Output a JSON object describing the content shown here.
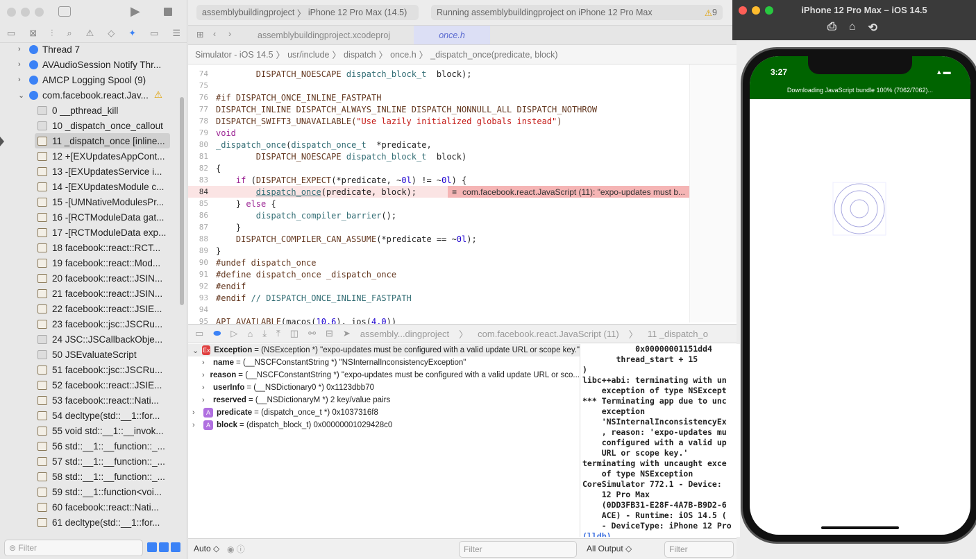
{
  "toolbar": {
    "scheme": "assemblybuildingproject",
    "device": "iPhone 12 Pro Max (14.5)",
    "status": "Running assemblybuildingproject on iPhone 12 Pro Max",
    "warnings": "9"
  },
  "tabs": [
    {
      "label": "assemblybuildingproject.xcodeproj"
    },
    {
      "label": "once.h"
    }
  ],
  "breadcrumb": [
    "Simulator - iOS 14.5",
    "usr/include",
    "dispatch",
    "once.h",
    "_dispatch_once(predicate, block)"
  ],
  "sidebar": {
    "threads": [
      {
        "label": "Thread 7"
      },
      {
        "label": "AVAudioSession Notify Thr..."
      },
      {
        "label": "AMCP Logging Spool (9)"
      },
      {
        "label": "com.facebook.react.Jav..."
      }
    ],
    "frames": [
      {
        "label": "0 __pthread_kill",
        "sys": true
      },
      {
        "label": "10 _dispatch_once_callout",
        "sys": true
      },
      {
        "label": "11 _dispatch_once [inline...",
        "selected": true
      },
      {
        "label": "12 +[EXUpdatesAppCont..."
      },
      {
        "label": "13 -[EXUpdatesService i..."
      },
      {
        "label": "14 -[EXUpdatesModule c..."
      },
      {
        "label": "15 -[UMNativeModulesPr..."
      },
      {
        "label": "16 -[RCTModuleData gat..."
      },
      {
        "label": "17 -[RCTModuleData exp..."
      },
      {
        "label": "18 facebook::react::RCT..."
      },
      {
        "label": "19 facebook::react::Mod..."
      },
      {
        "label": "20 facebook::react::JSIN..."
      },
      {
        "label": "21 facebook::react::JSIN..."
      },
      {
        "label": "22 facebook::react::JSIE..."
      },
      {
        "label": "23 facebook::jsc::JSCRu..."
      },
      {
        "label": "24 JSC::JSCallbackObje...",
        "sys": true
      },
      {
        "label": "50 JSEvaluateScript",
        "sys": true
      },
      {
        "label": "51 facebook::jsc::JSCRu..."
      },
      {
        "label": "52 facebook::react::JSIE..."
      },
      {
        "label": "53 facebook::react::Nati..."
      },
      {
        "label": "54 decltype(std::__1::for..."
      },
      {
        "label": "55 void std::__1::__invok..."
      },
      {
        "label": "56 std::__1::__function::_..."
      },
      {
        "label": "57 std::__1::__function::_..."
      },
      {
        "label": "58 std::__1::__function::_..."
      },
      {
        "label": "59 std::__1::function<voi..."
      },
      {
        "label": "60 facebook::react::Nati..."
      },
      {
        "label": "61 decltype(std::__1::for..."
      }
    ],
    "filter_placeholder": "Filter"
  },
  "code": [
    {
      "n": "74",
      "t": [
        [
          "m",
          "        DISPATCH_NOESCAPE "
        ],
        [
          "f",
          "dispatch_block_t"
        ],
        [
          "",
          "  block);"
        ]
      ]
    },
    {
      "n": "75",
      "t": []
    },
    {
      "n": "76",
      "t": [
        [
          "p",
          "#if DISPATCH_ONCE_INLINE_FASTPATH"
        ]
      ]
    },
    {
      "n": "77",
      "t": [
        [
          "m",
          "DISPATCH_INLINE DISPATCH_ALWAYS_INLINE DISPATCH_NONNULL_ALL DISPATCH_NOTHROW"
        ]
      ]
    },
    {
      "n": "78",
      "t": [
        [
          "m",
          "DISPATCH_SWIFT3_UNAVAILABLE("
        ],
        [
          "s",
          "\"Use lazily initialized globals instead\""
        ],
        [
          "m",
          ")"
        ]
      ]
    },
    {
      "n": "79",
      "t": [
        [
          "k",
          "void"
        ]
      ]
    },
    {
      "n": "80",
      "t": [
        [
          "f",
          "_dispatch_once"
        ],
        [
          "",
          "("
        ],
        [
          "f",
          "dispatch_once_t"
        ],
        [
          "",
          "  *predicate,"
        ]
      ]
    },
    {
      "n": "81",
      "t": [
        [
          "m",
          "        DISPATCH_NOESCAPE "
        ],
        [
          "f",
          "dispatch_block_t"
        ],
        [
          "",
          "  block)"
        ]
      ]
    },
    {
      "n": "82",
      "t": [
        [
          "",
          "{"
        ]
      ]
    },
    {
      "n": "83",
      "t": [
        [
          "",
          "    "
        ],
        [
          "k",
          "if"
        ],
        [
          "",
          " ("
        ],
        [
          "m",
          "DISPATCH_EXPECT"
        ],
        [
          "",
          "(*predicate, ~"
        ],
        [
          "n",
          "0l"
        ],
        [
          "",
          ") != ~"
        ],
        [
          "n",
          "0l"
        ],
        [
          "",
          ") {"
        ]
      ]
    },
    {
      "n": "84",
      "t": [
        [
          "",
          "        "
        ],
        [
          "u",
          "dispatch_once"
        ],
        [
          "",
          "(predicate, block);"
        ]
      ],
      "error": "com.facebook.react.JavaScript (11): \"expo-updates must b..."
    },
    {
      "n": "85",
      "t": [
        [
          "",
          "    } "
        ],
        [
          "k",
          "else"
        ],
        [
          "",
          " {"
        ]
      ]
    },
    {
      "n": "86",
      "t": [
        [
          "",
          "        "
        ],
        [
          "f",
          "dispatch_compiler_barrier"
        ],
        [
          "",
          "();"
        ]
      ]
    },
    {
      "n": "87",
      "t": [
        [
          "",
          "    }"
        ]
      ]
    },
    {
      "n": "88",
      "t": [
        [
          "",
          "    "
        ],
        [
          "m",
          "DISPATCH_COMPILER_CAN_ASSUME"
        ],
        [
          "",
          "(*predicate == ~"
        ],
        [
          "n",
          "0l"
        ],
        [
          "",
          ");"
        ]
      ]
    },
    {
      "n": "89",
      "t": [
        [
          "",
          "}"
        ]
      ]
    },
    {
      "n": "90",
      "t": [
        [
          "p",
          "#undef dispatch_once"
        ]
      ]
    },
    {
      "n": "91",
      "t": [
        [
          "p",
          "#define dispatch_once _dispatch_once"
        ]
      ]
    },
    {
      "n": "92",
      "t": [
        [
          "p",
          "#endif"
        ]
      ]
    },
    {
      "n": "93",
      "t": [
        [
          "p",
          "#endif "
        ],
        [
          "f",
          "// DISPATCH_ONCE_INLINE_FASTPATH"
        ]
      ]
    },
    {
      "n": "94",
      "t": []
    },
    {
      "n": "95",
      "t": [
        [
          "m",
          "API_AVAILABLE"
        ],
        [
          "",
          "(macos("
        ],
        [
          "n",
          "10.6"
        ],
        [
          "",
          "), ios("
        ],
        [
          "n",
          "4.0"
        ],
        [
          "",
          "))"
        ]
      ]
    }
  ],
  "debug_crumb": [
    "assembly...dingproject",
    "com.facebook.react.JavaScript (11)",
    "11 _dispatch_o"
  ],
  "variables": [
    {
      "name": "Exception",
      "type": "(NSException *)",
      "value": "\"expo-updates must be configured with a valid update URL or scope key.\"",
      "badge": "Ex",
      "level": 0,
      "open": true
    },
    {
      "name": "name",
      "type": "(__NSCFConstantString *)",
      "value": "\"NSInternalInconsistencyException\"",
      "level": 1
    },
    {
      "name": "reason",
      "type": "(__NSCFConstantString *)",
      "value": "\"expo-updates must be configured with a valid update URL or sco...",
      "level": 1
    },
    {
      "name": "userInfo",
      "type": "(__NSDictionary0 *)",
      "value": "0x1123dbb70",
      "level": 1
    },
    {
      "name": "reserved",
      "type": "(__NSDictionaryM *)",
      "value": "2 key/value pairs",
      "level": 1
    },
    {
      "name": "predicate",
      "type": "(dispatch_once_t *)",
      "value": "0x1037316f8",
      "badge": "A",
      "level": 0
    },
    {
      "name": "block",
      "type": "(dispatch_block_t)",
      "value": "0x00000001029428c0",
      "badge": "A",
      "level": 0
    }
  ],
  "console": {
    "text": "           0x00000001151dd4\n       thread_start + 15\n)\nlibc++abi: terminating with un\n    exception of type NSExcept\n*** Terminating app due to unc\n    exception\n    'NSInternalInconsistencyEx\n    , reason: 'expo-updates mu\n    configured with a valid up\n    URL or scope key.'\nterminating with uncaught exce\n    of type NSException\nCoreSimulator 772.1 - Device:\n    12 Pro Max\n    (0DD3FB31-E28F-4A7B-B9D2-6\n    ACE) - Runtime: iOS 14.5 (\n    - DeviceType: iPhone 12 Pro",
    "prompt": "(lldb)"
  },
  "bottom": {
    "auto": "Auto ◇",
    "filter": "Filter",
    "output": "All Output ◇",
    "filter2": "Filter"
  },
  "simulator": {
    "title": "iPhone 12 Pro Max – iOS 14.5",
    "time": "3:27",
    "banner": "Downloading JavaScript bundle 100% (7062/7062)...",
    "banner_color": "#006400"
  }
}
